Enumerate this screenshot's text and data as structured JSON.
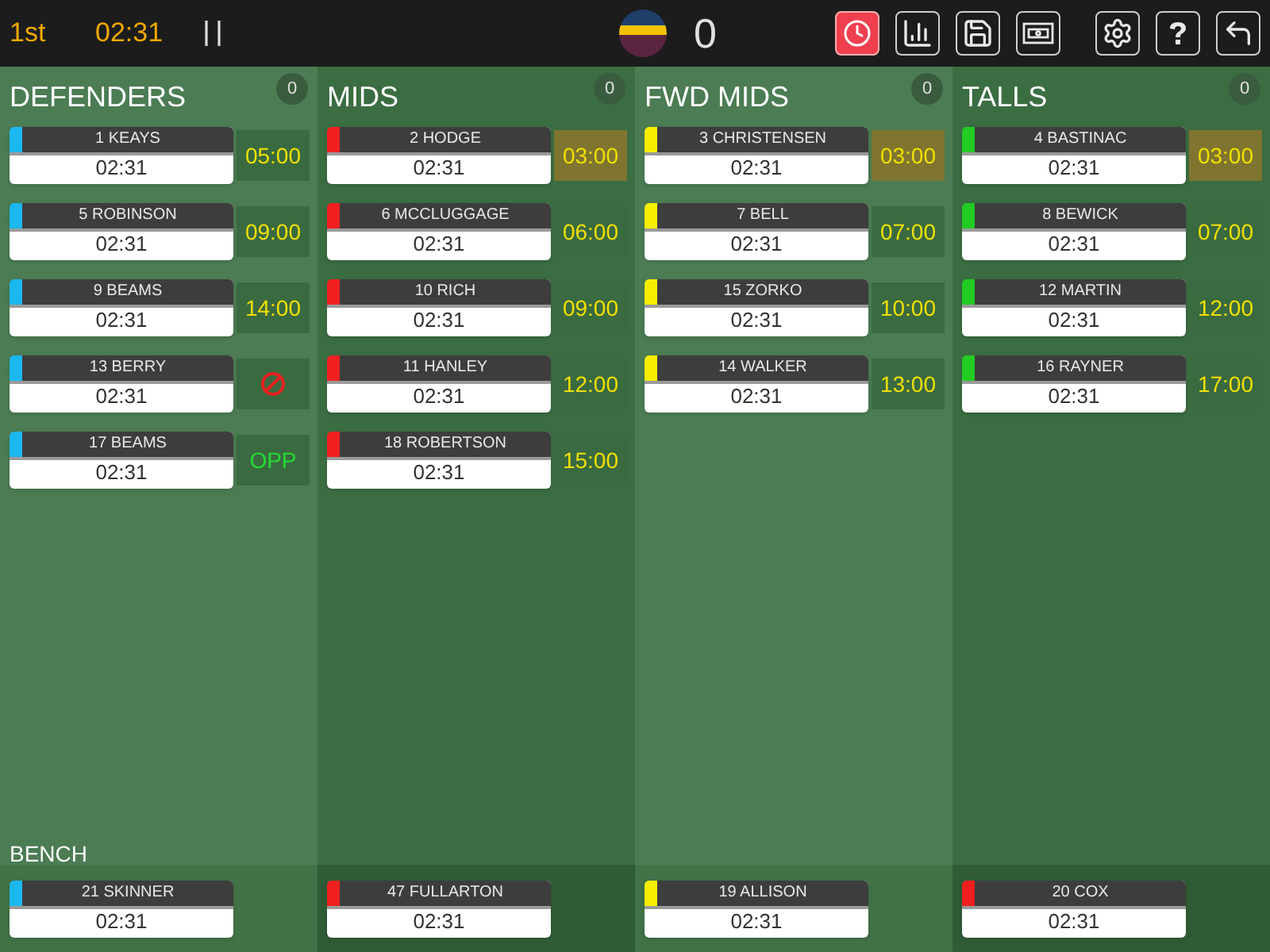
{
  "top_bar": {
    "period": "1st",
    "clock": "02:31",
    "score": "0",
    "toolbar": [
      {
        "kind": "clock",
        "selected": true
      },
      {
        "kind": "stats",
        "selected": false
      },
      {
        "kind": "save",
        "selected": false
      },
      {
        "kind": "ticket",
        "selected": false
      },
      {
        "kind": "settings",
        "selected": false
      },
      {
        "kind": "help",
        "selected": false
      },
      {
        "kind": "exit",
        "selected": false
      }
    ]
  },
  "columns": [
    {
      "title": "DEFENDERS",
      "count": "0",
      "players": [
        {
          "name": "1 KEAYS",
          "time": "02:31",
          "color": "#1ab8ef",
          "side": {
            "kind": "time",
            "text": "05:00",
            "highlighted": false
          }
        },
        {
          "name": "5 ROBINSON",
          "time": "02:31",
          "color": "#1ab8ef",
          "side": {
            "kind": "time",
            "text": "09:00",
            "highlighted": false
          }
        },
        {
          "name": "9 BEAMS",
          "time": "02:31",
          "color": "#1ab8ef",
          "side": {
            "kind": "time",
            "text": "14:00",
            "highlighted": false
          }
        },
        {
          "name": "13 BERRY",
          "time": "02:31",
          "color": "#1ab8ef",
          "side": {
            "kind": "blocked",
            "highlighted": false
          }
        },
        {
          "name": "17 BEAMS",
          "time": "02:31",
          "color": "#1ab8ef",
          "side": {
            "kind": "opp",
            "text": "OPP",
            "highlighted": false
          }
        }
      ]
    },
    {
      "title": "MIDS",
      "count": "0",
      "players": [
        {
          "name": "2 HODGE",
          "time": "02:31",
          "color": "#f02020",
          "side": {
            "kind": "time",
            "text": "03:00",
            "highlighted": true
          }
        },
        {
          "name": "6 MCCLUGGAGE",
          "time": "02:31",
          "color": "#f02020",
          "side": {
            "kind": "time",
            "text": "06:00",
            "highlighted": false
          }
        },
        {
          "name": "10 RICH",
          "time": "02:31",
          "color": "#f02020",
          "side": {
            "kind": "time",
            "text": "09:00",
            "highlighted": false
          }
        },
        {
          "name": "11 HANLEY",
          "time": "02:31",
          "color": "#f02020",
          "side": {
            "kind": "time",
            "text": "12:00",
            "highlighted": false
          }
        },
        {
          "name": "18 ROBERTSON",
          "time": "02:31",
          "color": "#f02020",
          "side": {
            "kind": "time",
            "text": "15:00",
            "highlighted": false
          }
        }
      ]
    },
    {
      "title": "FWD MIDS",
      "count": "0",
      "players": [
        {
          "name": "3 CHRISTENSEN",
          "time": "02:31",
          "color": "#f5ee00",
          "side": {
            "kind": "time",
            "text": "03:00",
            "highlighted": true
          }
        },
        {
          "name": "7 BELL",
          "time": "02:31",
          "color": "#f5ee00",
          "side": {
            "kind": "time",
            "text": "07:00",
            "highlighted": false
          }
        },
        {
          "name": "15 ZORKO",
          "time": "02:31",
          "color": "#f5ee00",
          "side": {
            "kind": "time",
            "text": "10:00",
            "highlighted": false
          }
        },
        {
          "name": "14 WALKER",
          "time": "02:31",
          "color": "#f5ee00",
          "side": {
            "kind": "time",
            "text": "13:00",
            "highlighted": false
          }
        }
      ]
    },
    {
      "title": "TALLS",
      "count": "0",
      "players": [
        {
          "name": "4 BASTINAC",
          "time": "02:31",
          "color": "#22cc22",
          "side": {
            "kind": "time",
            "text": "03:00",
            "highlighted": true
          }
        },
        {
          "name": "8 BEWICK",
          "time": "02:31",
          "color": "#22cc22",
          "side": {
            "kind": "time",
            "text": "07:00",
            "highlighted": false
          }
        },
        {
          "name": "12 MARTIN",
          "time": "02:31",
          "color": "#22cc22",
          "side": {
            "kind": "time",
            "text": "12:00",
            "highlighted": false
          }
        },
        {
          "name": "16 RAYNER",
          "time": "02:31",
          "color": "#22cc22",
          "side": {
            "kind": "time",
            "text": "17:00",
            "highlighted": false
          }
        }
      ]
    }
  ],
  "bench": {
    "label": "BENCH",
    "players": [
      {
        "name": "21 SKINNER",
        "time": "02:31",
        "color": "#1ab8ef"
      },
      {
        "name": "47 FULLARTON",
        "time": "02:31",
        "color": "#f02020"
      },
      {
        "name": "19 ALLISON",
        "time": "02:31",
        "color": "#f5ee00"
      },
      {
        "name": "20 COX",
        "time": "02:31",
        "color": "#f02020"
      }
    ]
  }
}
